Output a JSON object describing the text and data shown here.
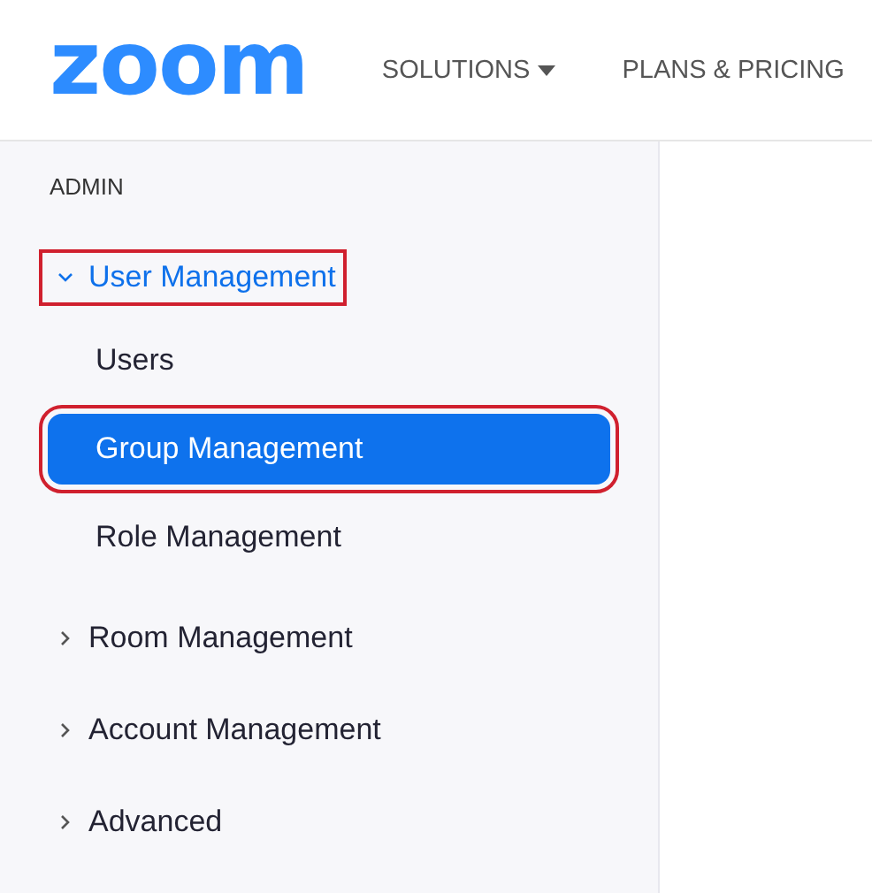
{
  "header": {
    "logo": "zoom",
    "nav": [
      {
        "label": "SOLUTIONS",
        "has_menu": true
      },
      {
        "label": "PLANS & PRICING",
        "has_menu": false
      }
    ]
  },
  "sidebar": {
    "section_label": "ADMIN",
    "items": [
      {
        "label": "User Management",
        "expanded": true,
        "highlighted": true,
        "children": [
          {
            "label": "Users",
            "selected": false,
            "highlighted": false
          },
          {
            "label": "Group Management",
            "selected": true,
            "highlighted": true
          },
          {
            "label": "Role Management",
            "selected": false,
            "highlighted": false
          }
        ]
      },
      {
        "label": "Room Management",
        "expanded": false,
        "highlighted": false
      },
      {
        "label": "Account Management",
        "expanded": false,
        "highlighted": false
      },
      {
        "label": "Advanced",
        "expanded": false,
        "highlighted": false
      }
    ]
  }
}
